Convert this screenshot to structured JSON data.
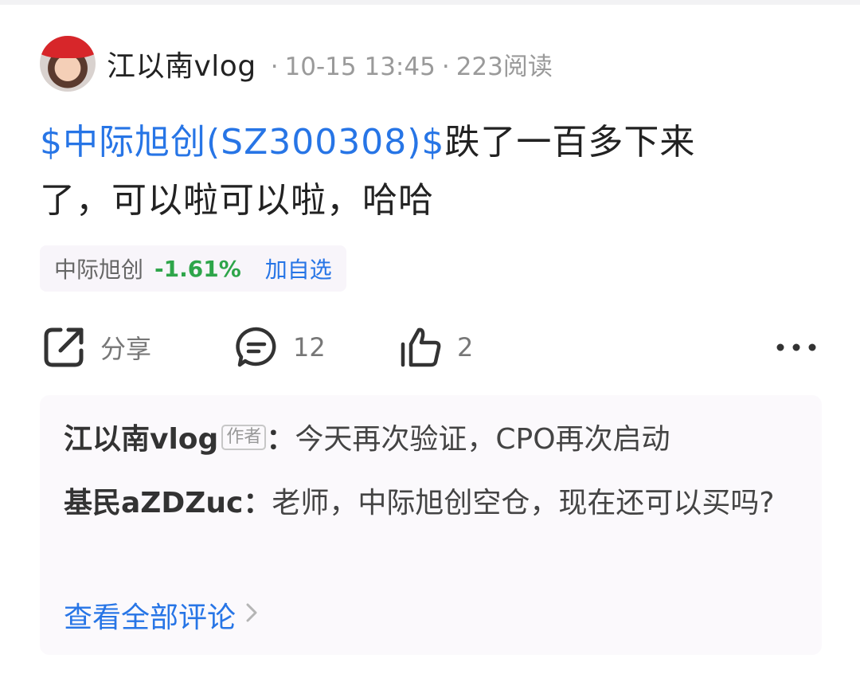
{
  "post": {
    "author": "江以南vlog",
    "sep1": "·",
    "time": "10-15 13:45",
    "sep2": "·",
    "reads": "223阅读",
    "stock_tag": "$中际旭创(SZ300308)$",
    "text": "跌了一百多下来了，可以啦可以啦，哈哈"
  },
  "stock_chip": {
    "name": "中际旭创",
    "change": "-1.61%",
    "add_label": "加自选"
  },
  "actions": {
    "share_label": "分享",
    "comment_count": "12",
    "like_count": "2"
  },
  "comments": [
    {
      "author": "江以南vlog",
      "tag": "作者",
      "colon": "：",
      "text": "今天再次验证，CPO再次启动"
    },
    {
      "author": "基民aZDZuc",
      "colon": "：",
      "text": "老师，中际旭创空仓，现在还可以买吗?"
    }
  ],
  "view_all_label": "查看全部评论",
  "icons": {
    "share": "share-icon",
    "comment": "comment-icon",
    "like": "thumbs-up-icon",
    "more": "more-dots-icon",
    "chevron": "chevron-right-icon"
  },
  "colors": {
    "link_blue": "#2775e6",
    "change_green": "#2ea54a",
    "meta_gray": "#9a9a9a"
  }
}
